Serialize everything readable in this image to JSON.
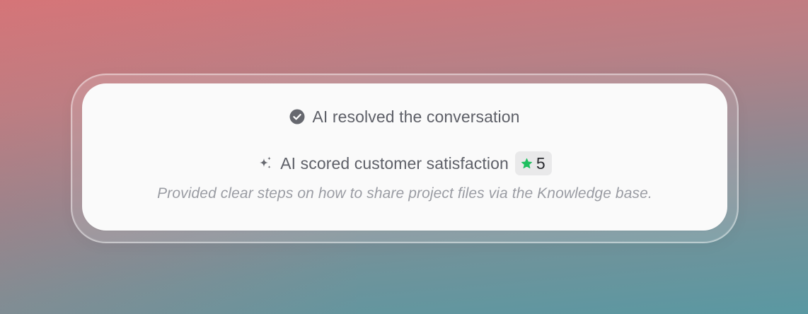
{
  "status": {
    "icon": "check-circle-icon",
    "text": "AI resolved the conversation"
  },
  "satisfaction": {
    "icon": "sparkles-icon",
    "text": "AI scored customer satisfaction",
    "score_icon": "star-icon",
    "score": "5",
    "note": "Provided clear steps on how to share project files via the Knowledge base."
  },
  "colors": {
    "star": "#1fbf5f",
    "icon": "#66686f",
    "text": "#5e6068",
    "note": "#9a9ca3"
  }
}
